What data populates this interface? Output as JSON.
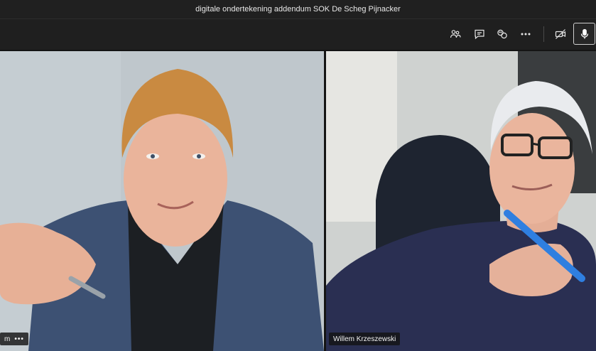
{
  "window": {
    "title": "digitale ondertekening addendum SOK De Scheg Pijnacker"
  },
  "toolbar": {
    "buttons": [
      {
        "icon": "participants-icon"
      },
      {
        "icon": "chat-icon"
      },
      {
        "icon": "reactions-icon"
      },
      {
        "icon": "more-options-icon"
      },
      {
        "icon": "camera-off-icon"
      },
      {
        "icon": "microphone-icon"
      }
    ]
  },
  "participants": {
    "left": {
      "name": "m",
      "more": "•••"
    },
    "right": {
      "name": "Willem Krzeszewski"
    }
  },
  "colors": {
    "background": "#1f1f1f",
    "accent": "#ffffff"
  }
}
